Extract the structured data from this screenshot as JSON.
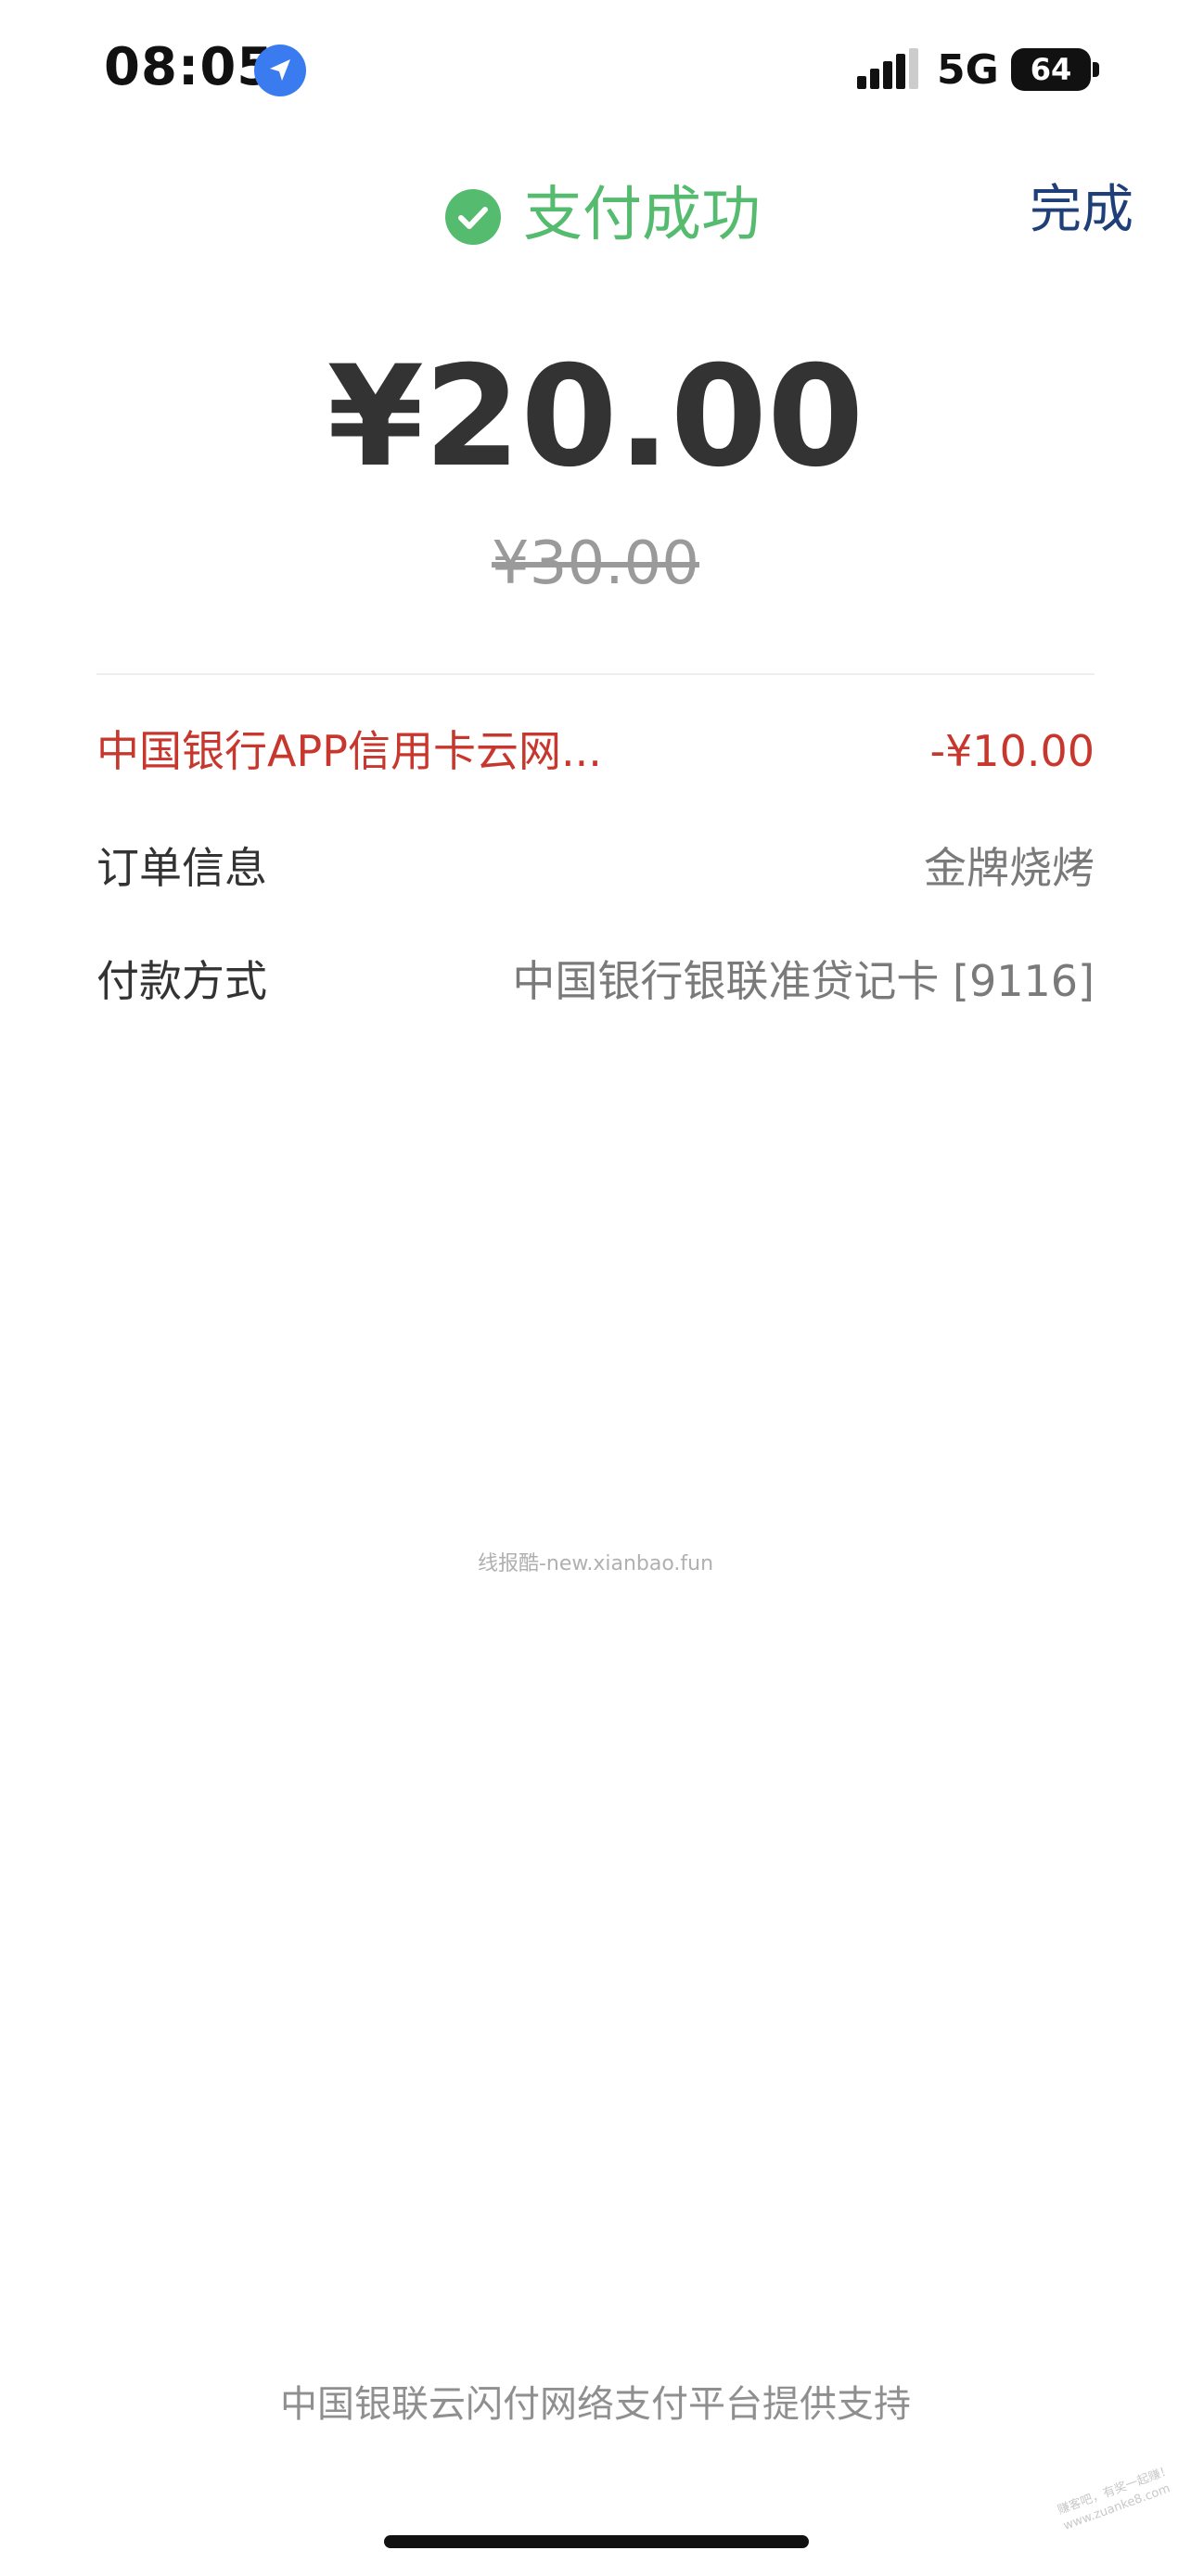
{
  "status_bar": {
    "time": "08:05",
    "network": "5G",
    "battery": "64",
    "location_icon": "location-arrow-icon",
    "signal_icon": "signal-bars-icon"
  },
  "header": {
    "title": "支付成功",
    "done_label": "完成",
    "check_icon": "check-circle-icon"
  },
  "payment": {
    "amount": "¥20.00",
    "original_amount": "¥30.00"
  },
  "details": {
    "discount_label": "中国银行APP信用卡云网...",
    "discount_value": "-¥10.00",
    "order_label": "订单信息",
    "order_value": "金牌烧烤",
    "payment_method_label": "付款方式",
    "payment_method_value": "中国银行银联准贷记卡 [9116]"
  },
  "watermark": "线报酷-new.xianbao.fun",
  "footer": "中国银联云闪付网络支付平台提供支持",
  "corner_watermark": "赚客吧，有奖一起赚！ www.zuanke8.com",
  "colors": {
    "success_green": "#55bb6e",
    "discount_red": "#c8372d",
    "done_blue": "#1f3f78",
    "location_blue": "#3a7cf0"
  }
}
